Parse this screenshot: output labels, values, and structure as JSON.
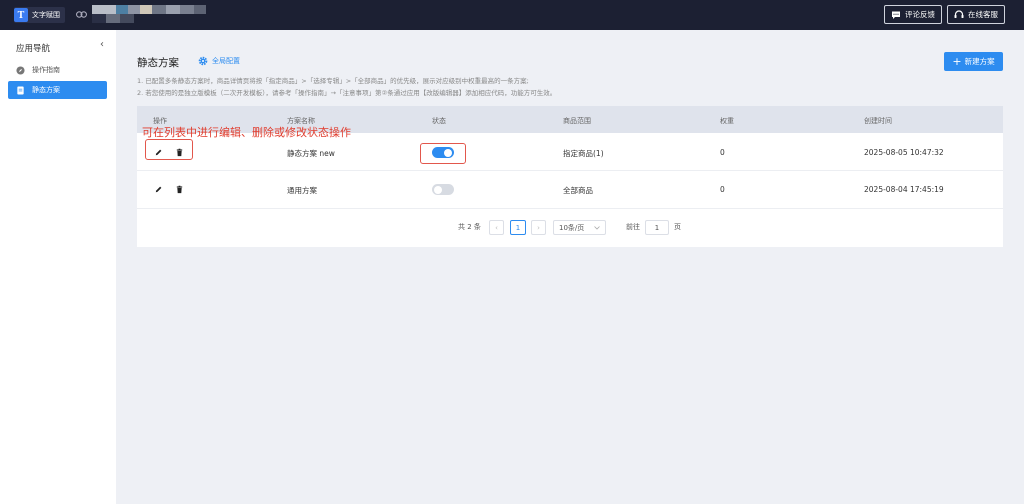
{
  "topbar": {
    "app_name": "文字赋围",
    "logo_letter": "T",
    "feedback_label": "评论反馈",
    "support_label": "在线客服"
  },
  "sidebar": {
    "title": "应用导航",
    "collapse_glyph": "‹",
    "items": [
      {
        "label": "操作指南",
        "icon": "compass-icon",
        "active": false
      },
      {
        "label": "静态方案",
        "icon": "doc-icon",
        "active": true
      }
    ]
  },
  "main": {
    "title": "静态方案",
    "global_config_label": "全局配置",
    "new_button_label": "新建方案",
    "notes": [
      "1. 已配置多条静态方案时，商品详情页将按「指定商品」>「选择专辑」>「全部商品」的优先级，展示对应级别中权重最高的一条方案;",
      "2. 若您使用的是独立版模板（二次开发模板），请参考「操作指南」→「注意事项」第②条通过应用【改版编辑器】添加相应代码，功能方可生效。"
    ],
    "annotation": "可在列表中进行编辑、删除或修改状态操作"
  },
  "table": {
    "columns": [
      "操作",
      "方案名称",
      "状态",
      "商品范围",
      "权重",
      "创建时间"
    ],
    "rows": [
      {
        "name": "静态方案 new",
        "status_on": true,
        "scope": "指定商品(1)",
        "weight": "0",
        "created": "2025-08-05 10:47:32"
      },
      {
        "name": "通用方案",
        "status_on": false,
        "scope": "全部商品",
        "weight": "0",
        "created": "2025-08-04 17:45:19"
      }
    ]
  },
  "pagination": {
    "total_text": "共 2 条",
    "prev_glyph": "‹",
    "current_page": "1",
    "next_glyph": "›",
    "page_size": "10条/页",
    "goto_label": "前往",
    "goto_value": "1",
    "page_unit": "页"
  },
  "colors": {
    "topbar_bg": "#1c2033",
    "accent": "#2d8cf0",
    "annotation": "#e03c2d"
  }
}
